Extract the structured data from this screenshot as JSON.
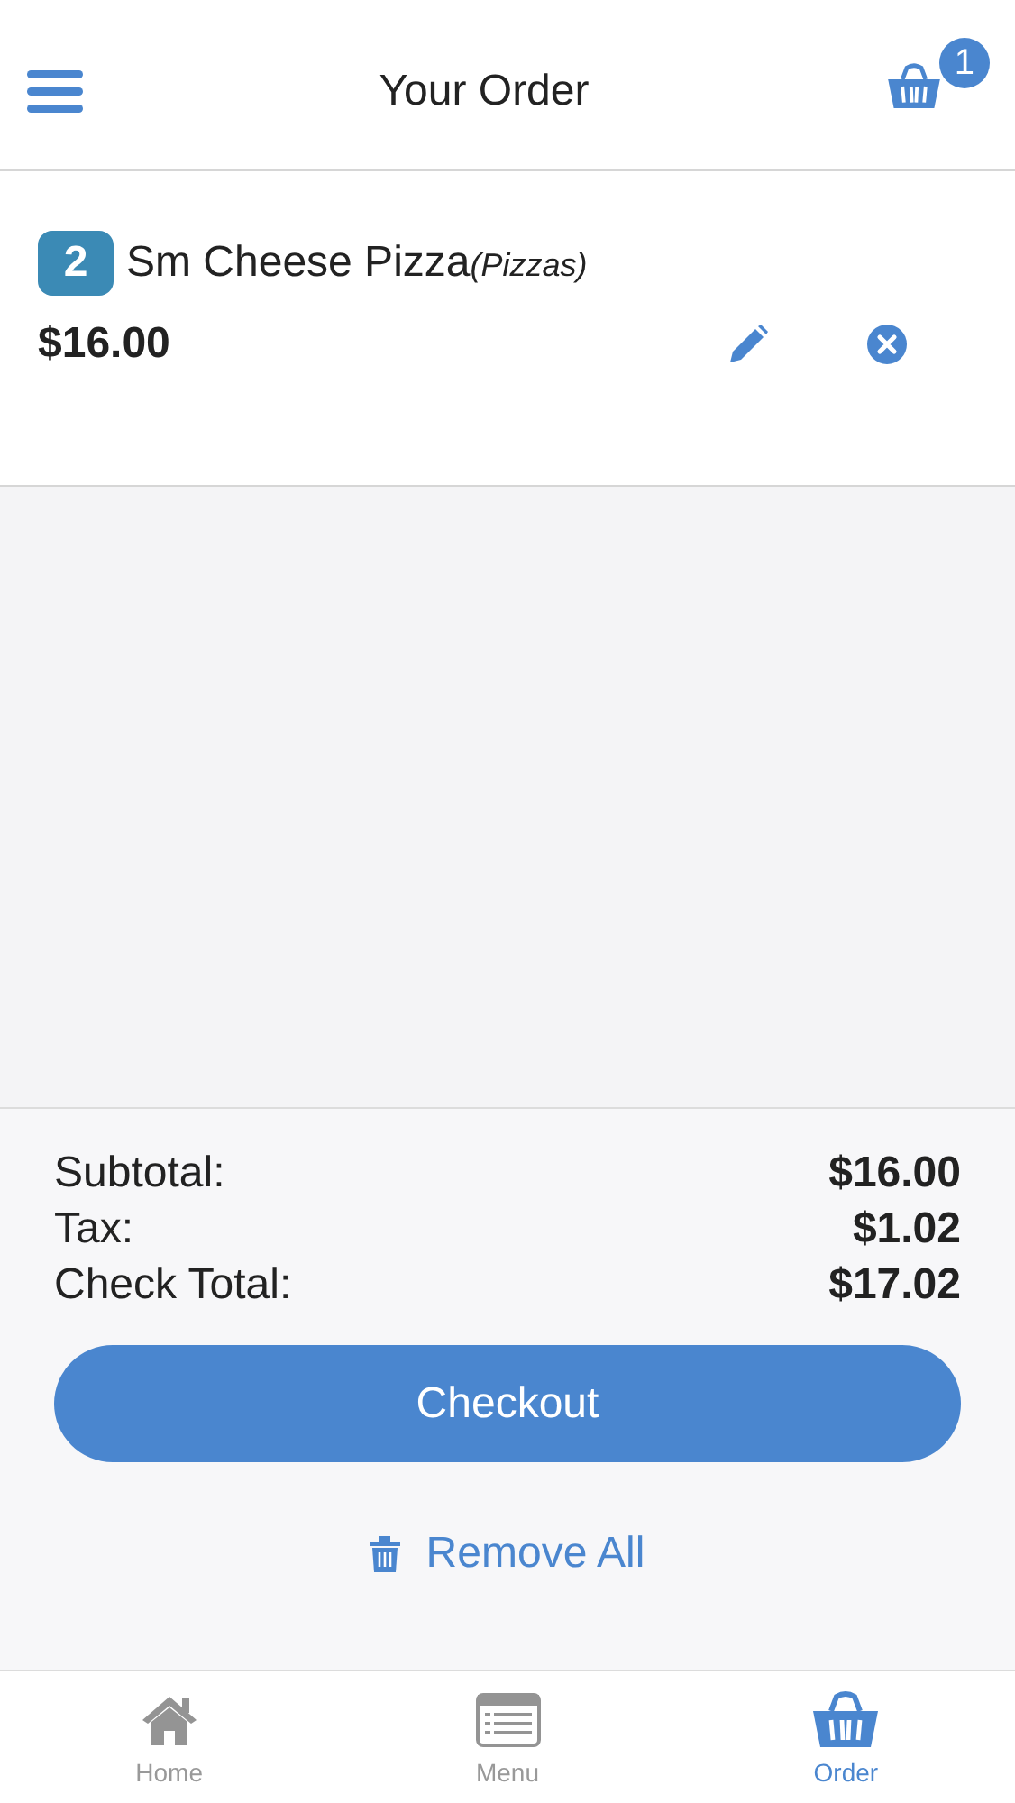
{
  "header": {
    "title": "Your Order",
    "cart_count": "1"
  },
  "items": [
    {
      "quantity": "2",
      "name": "Sm Cheese Pizza",
      "category": "(Pizzas)",
      "price": "$16.00"
    }
  ],
  "totals": [
    {
      "label": "Subtotal:",
      "value": "$16.00"
    },
    {
      "label": "Tax:",
      "value": "$1.02"
    },
    {
      "label": "Check Total:",
      "value": "$17.02"
    }
  ],
  "checkout_button": "Checkout",
  "remove_all": "Remove All",
  "tabs": [
    {
      "kind": "home",
      "label": "Home",
      "selected": false
    },
    {
      "kind": "menu",
      "label": "Menu",
      "selected": false
    },
    {
      "kind": "order",
      "label": "Order",
      "selected": true
    }
  ]
}
